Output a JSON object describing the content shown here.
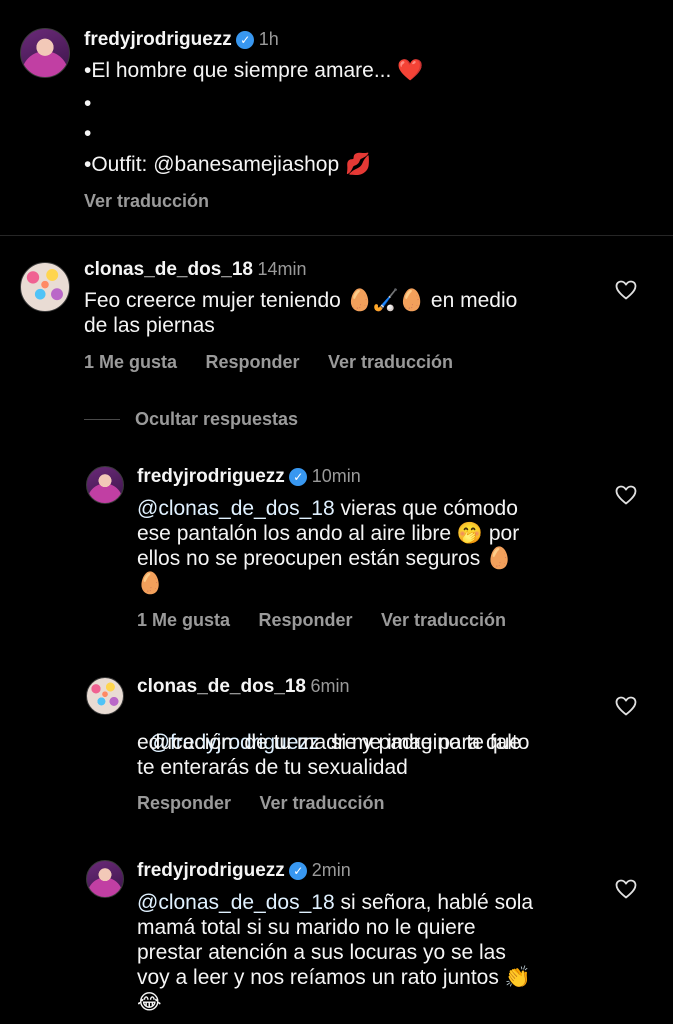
{
  "post": {
    "username": "fredyjrodriguezz",
    "time": "1h",
    "lines": [
      "•El hombre que siempre amare... ❤️",
      "•",
      "•",
      "•Outfit: @banesamejiashop 💋"
    ],
    "translate": "Ver traducción"
  },
  "comments": [
    {
      "username": "clonas_de_dos_18",
      "time": "14min",
      "text_lines": [
        "Feo creerce  mujer teniendo 🥚🏑🥚 en medio",
        "de las piernas"
      ],
      "likes": "1 Me gusta",
      "reply": "Responder",
      "translate": "Ver traducción",
      "hide_replies": "Ocultar respuestas"
    }
  ],
  "replies": [
    {
      "username": "fredyjrodriguezz",
      "time": "10min",
      "mention": "@clonas_de_dos_18",
      "text_lines": [
        " vieras que cómodo",
        "ese pantalón los ando al aire libre 🤭 por",
        "ellos no se preocupen están seguros 🥚",
        "🥚"
      ],
      "likes": "1 Me gusta",
      "reply": "Responder",
      "translate": "Ver traducción"
    },
    {
      "username": "clonas_de_dos_18",
      "time": "6min",
      "mention": "@fredyjrodriguezz",
      "text_lines": [
        "  si me imagino te falto",
        "educación  de tu madre y padre para que",
        "te enterarás de tu sexualidad"
      ],
      "reply": "Responder",
      "translate": "Ver traducción"
    },
    {
      "username": "fredyjrodriguezz",
      "time": "2min",
      "mention": "@clonas_de_dos_18",
      "text_lines": [
        " si señora, hablé sola",
        "mamá total si su marido no le quiere",
        "prestar atención a sus locuras yo se las",
        "voy a leer y nos reíamos un rato juntos 👏",
        "😂"
      ]
    }
  ],
  "icons": {
    "verified": "verified-badge-icon",
    "like": "heart-outline-icon"
  },
  "colors": {
    "background": "#000000",
    "text": "#f5f5f5",
    "secondary": "#9a9a9a",
    "verified": "#3897f0"
  }
}
